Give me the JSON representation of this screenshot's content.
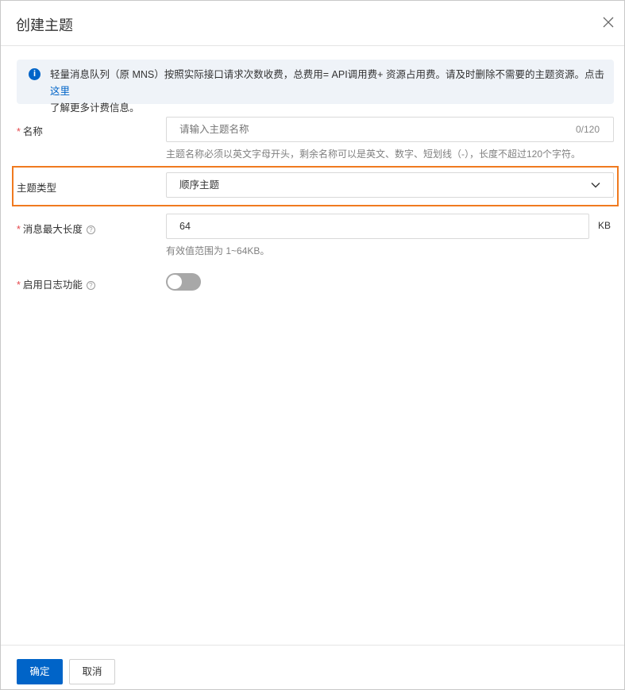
{
  "dialog": {
    "title": "创建主题"
  },
  "notice": {
    "text": "轻量消息队列（原 MNS）按照实际接口请求次数收费，总费用= API调用费+ 资源占用费。请及时删除不需要的主题资源。点击",
    "link": "这里",
    "text2": "了解更多计费信息。"
  },
  "form": {
    "name": {
      "required": "*",
      "label": "名称",
      "placeholder": "请输入主题名称",
      "counter": "0/120",
      "help": "主题名称必须以英文字母开头，剩余名称可以是英文、数字、短划线（-），长度不超过120个字符。"
    },
    "type": {
      "label": "主题类型",
      "value": "顺序主题"
    },
    "max_size": {
      "required": "*",
      "label": "消息最大长度",
      "value": "64",
      "unit": "KB",
      "help": "有效值范围为 1~64KB。"
    },
    "logging": {
      "required": "*",
      "label": "启用日志功能",
      "enabled": false
    }
  },
  "footer": {
    "ok": "确定",
    "cancel": "取消"
  },
  "colors": {
    "primary": "#0064c8",
    "highlight": "#f07a1f"
  }
}
